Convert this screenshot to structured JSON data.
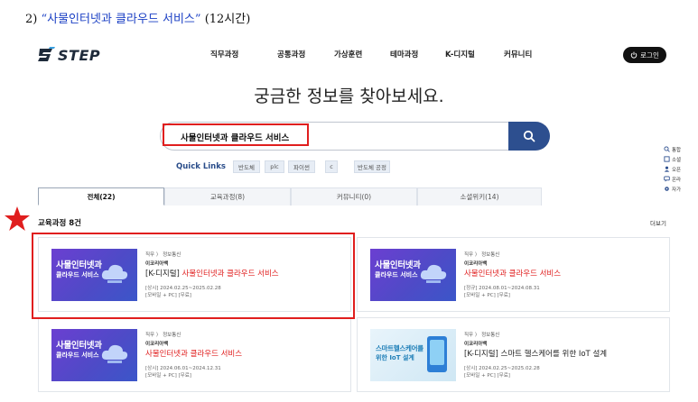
{
  "doc_heading": {
    "number": "2)",
    "open_quote": "“",
    "title": "사물인터넷과 클라우드 서비스",
    "close_quote": "”",
    "suffix": "(12시간)"
  },
  "nav": {
    "logo_text": "STEP",
    "menu": [
      "직무과정",
      "공통과정",
      "가상훈련",
      "테마과정",
      "K-디지털",
      "커뮤니티"
    ],
    "login_label": "로그인",
    "login_icon": "power-icon"
  },
  "hero_title": "궁금한 정보를 찾아보세요.",
  "search": {
    "value": "사물인터넷과 클라우드 서비스",
    "icon": "search-icon"
  },
  "quick_links": {
    "label": "Quick Links",
    "chips": [
      "반도체",
      "plc",
      "파이썬",
      "c",
      "반도체 공정"
    ]
  },
  "side_menu": [
    {
      "icon": "search-icon",
      "label": "통합"
    },
    {
      "icon": "bookmark-icon",
      "label": "소셜"
    },
    {
      "icon": "user-icon",
      "label": "오픈"
    },
    {
      "icon": "chat-icon",
      "label": "온라"
    },
    {
      "icon": "settings-icon",
      "label": "자가"
    }
  ],
  "tabs": [
    "전체(22)",
    "교육과정(8)",
    "커뮤니티(0)",
    "소셜위키(14)"
  ],
  "section": {
    "title": "교육과정 8건",
    "more": "더보기"
  },
  "cards": [
    {
      "thumb_line1": "사물인터넷과",
      "thumb_line2": "클라우드 서비스",
      "category": "직무 〉 정보통신",
      "org": "이코리아백",
      "title_prefix": "[K-디지털]",
      "title_highlight": "사물인터넷과 클라우드 서비스",
      "period": "[상시] 2024.02.25~2025.02.28",
      "mode": "[모바일 + PC] [무료]"
    },
    {
      "thumb_line1": "사물인터넷과",
      "thumb_line2": "클라우드 서비스",
      "category": "직무 〉 정보통신",
      "org": "이코리아백",
      "title_prefix": "",
      "title_highlight": "사물인터넷과 클라우드 서비스",
      "period": "[정규] 2024.08.01~2024.08.31",
      "mode": "[모바일 + PC] [무료]"
    },
    {
      "thumb_line1": "사물인터넷과",
      "thumb_line2": "클라우드 서비스",
      "category": "직무 〉 정보통신",
      "org": "이코리아백",
      "title_prefix": "",
      "title_highlight": "사물인터넷과 클라우드 서비스",
      "period": "[상시] 2024.06.01~2024.12.31",
      "mode": "[모바일 + PC] [무료]"
    },
    {
      "thumb_line1": "스마트헬스케어를",
      "thumb_line2": "위한 IoT 설계",
      "category": "직무 〉 정보통신",
      "org": "이코리아백",
      "title_prefix": "[K-디지털] 스마트 헬스케어를 위한 IoT 설계",
      "title_highlight": "",
      "period": "[상시] 2024.02.25~2025.02.28",
      "mode": "[모바일 + PC] [무료]"
    }
  ],
  "colors": {
    "accent_red": "#e01e1e",
    "search_button": "#2d4f8f",
    "quote_blue": "#1a3fc4",
    "thumb_purple": "#5a45cc"
  }
}
